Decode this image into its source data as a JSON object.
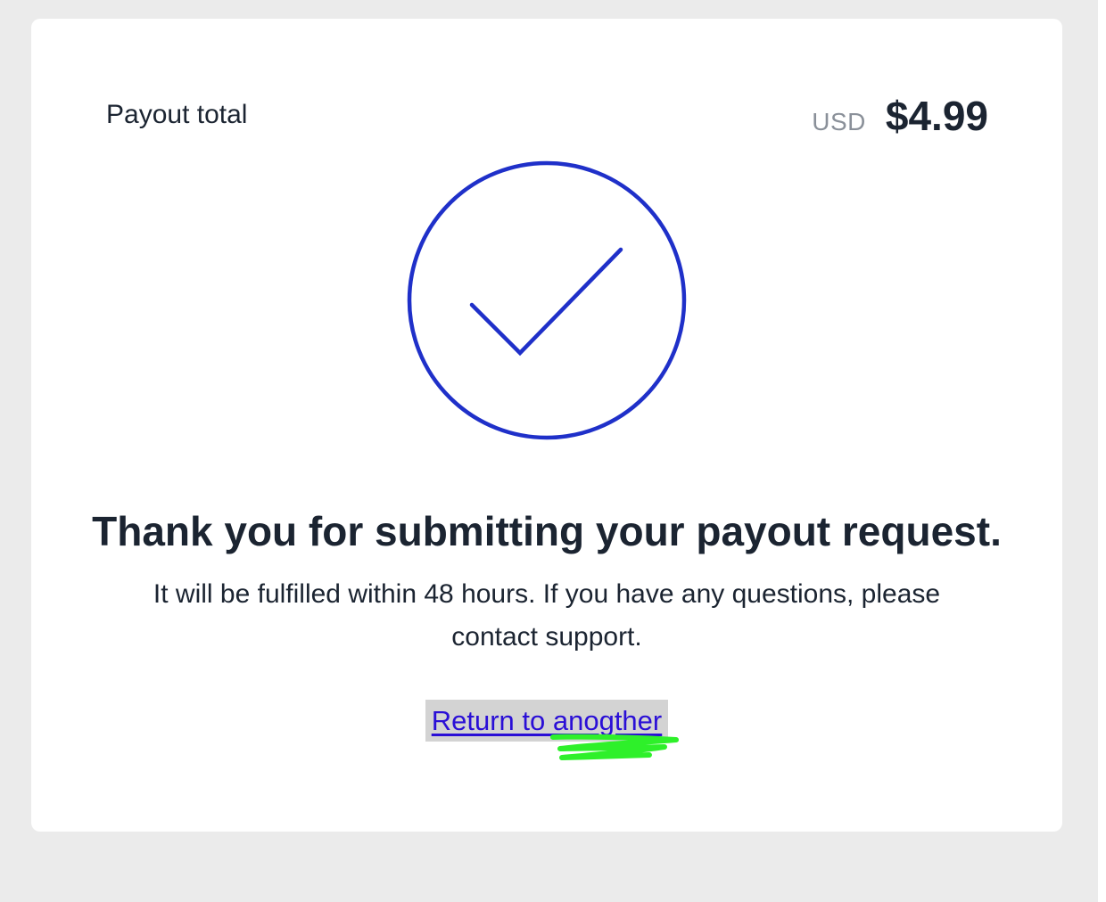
{
  "payout": {
    "label": "Payout total",
    "currency": "USD",
    "amount": "$4.99"
  },
  "success_icon": "check-circle-icon",
  "message": {
    "heading": "Thank you for submitting your payout request.",
    "body": "It will be fulfilled within 48 hours. If you have any questions, please contact support."
  },
  "link": {
    "label": "Return to anogther"
  },
  "colors": {
    "accent": "#1f30c9",
    "link": "#2a0fd6",
    "text": "#1b2431",
    "muted": "#8a9099",
    "link_highlight": "#d3d3d3",
    "markup_scribble": "#2ef02a",
    "page_background": "#ebebeb"
  }
}
